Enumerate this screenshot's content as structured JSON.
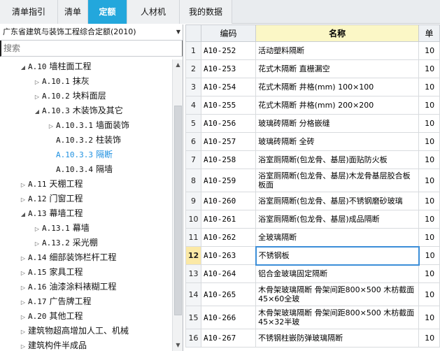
{
  "tabs": [
    {
      "label": "清单指引"
    },
    {
      "label": "清单"
    },
    {
      "label": "定额"
    },
    {
      "label": "人材机"
    },
    {
      "label": "我的数据"
    }
  ],
  "left_panel": {
    "dropdown_value": "广东省建筑与装饰工程综合定额(2010)",
    "search_placeholder": "搜索",
    "tree": [
      {
        "code": "A.10",
        "label": "墙柱面工程",
        "expanded": true,
        "selected": false
      },
      {
        "code": "A.10.1",
        "label": "抹灰",
        "expanded": false,
        "selected": false
      },
      {
        "code": "A.10.2",
        "label": "块料面层",
        "expanded": false,
        "selected": false
      },
      {
        "code": "A.10.3",
        "label": "木装饰及其它",
        "expanded": true,
        "selected": false
      },
      {
        "code": "A.10.3.1",
        "label": "墙面装饰",
        "expanded": false,
        "selected": false
      },
      {
        "code": "A.10.3.2",
        "label": "柱装饰",
        "expanded": false,
        "selected": false
      },
      {
        "code": "A.10.3.3",
        "label": "隔断",
        "expanded": false,
        "selected": true
      },
      {
        "code": "A.10.3.4",
        "label": "隔墙",
        "expanded": false,
        "selected": false
      },
      {
        "code": "A.11",
        "label": "天棚工程",
        "expanded": false,
        "selected": false
      },
      {
        "code": "A.12",
        "label": "门窗工程",
        "expanded": false,
        "selected": false
      },
      {
        "code": "A.13",
        "label": "幕墙工程",
        "expanded": true,
        "selected": false
      },
      {
        "code": "A.13.1",
        "label": "幕墙",
        "expanded": false,
        "selected": false
      },
      {
        "code": "A.13.2",
        "label": "采光棚",
        "expanded": false,
        "selected": false
      },
      {
        "code": "A.14",
        "label": "细部装饰栏杆工程",
        "expanded": false,
        "selected": false
      },
      {
        "code": "A.15",
        "label": "家具工程",
        "expanded": false,
        "selected": false
      },
      {
        "code": "A.16",
        "label": "油漆涂料裱糊工程",
        "expanded": false,
        "selected": false
      },
      {
        "code": "A.17",
        "label": "广告牌工程",
        "expanded": false,
        "selected": false
      },
      {
        "code": "A.20",
        "label": "其他工程",
        "expanded": false,
        "selected": false
      },
      {
        "code": "",
        "label": "建筑物超高增加人工、机械",
        "expanded": false,
        "selected": false
      },
      {
        "code": "",
        "label": "建筑构件半成品",
        "expanded": false,
        "selected": false
      }
    ]
  },
  "grid": {
    "headers": {
      "code": "编码",
      "name": "名称",
      "unit": "单"
    },
    "rows": [
      {
        "num": "1",
        "code": "A10-252",
        "name": "活动塑料隔断",
        "unit": "10"
      },
      {
        "num": "2",
        "code": "A10-253",
        "name": "花式木隔断 直栅漏空",
        "unit": "10"
      },
      {
        "num": "3",
        "code": "A10-254",
        "name": "花式木隔断 井格(mm) 100×100",
        "unit": "10"
      },
      {
        "num": "4",
        "code": "A10-255",
        "name": "花式木隔断 井格(mm) 200×200",
        "unit": "10"
      },
      {
        "num": "5",
        "code": "A10-256",
        "name": "玻璃砖隔断 分格嵌缝",
        "unit": "10"
      },
      {
        "num": "6",
        "code": "A10-257",
        "name": "玻璃砖隔断 全砖",
        "unit": "10"
      },
      {
        "num": "7",
        "code": "A10-258",
        "name": "浴室厕隔断(包龙骨、基层)面贴防火板",
        "unit": "10"
      },
      {
        "num": "8",
        "code": "A10-259",
        "name": "浴室厕隔断(包龙骨、基层)木龙骨基层胶合板板面",
        "unit": "10"
      },
      {
        "num": "9",
        "code": "A10-260",
        "name": "浴室厕隔断(包龙骨、基层)不锈钢磨砂玻璃",
        "unit": "10"
      },
      {
        "num": "10",
        "code": "A10-261",
        "name": "浴室厕隔断(包龙骨、基层)成品隔断",
        "unit": "10"
      },
      {
        "num": "11",
        "code": "A10-262",
        "name": "全玻璃隔断",
        "unit": "10"
      },
      {
        "num": "12",
        "code": "A10-263",
        "name": "不锈钢板",
        "unit": "10"
      },
      {
        "num": "13",
        "code": "A10-264",
        "name": "铝合金玻璃固定隔断",
        "unit": "10"
      },
      {
        "num": "14",
        "code": "A10-265",
        "name": "木骨架玻璃隔断 骨架间距800×500 木枋截面45×60全玻",
        "unit": "10"
      },
      {
        "num": "15",
        "code": "A10-266",
        "name": "木骨架玻璃隔断 骨架间距800×500 木枋截面45×32半玻",
        "unit": "10"
      },
      {
        "num": "16",
        "code": "A10-267",
        "name": "不锈钢柱嵌防弹玻璃隔断",
        "unit": "10"
      }
    ],
    "current_row": "12"
  }
}
